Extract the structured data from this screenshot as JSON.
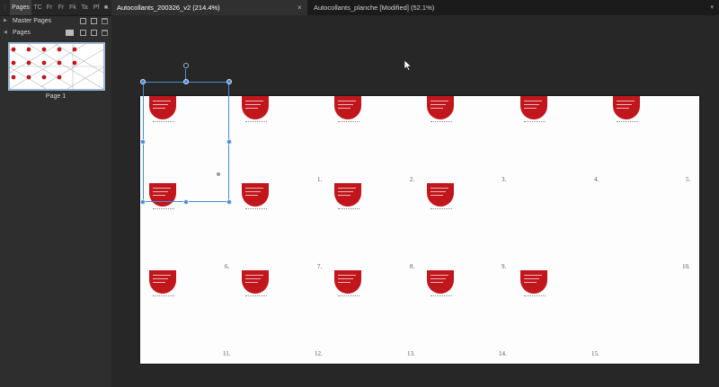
{
  "panel": {
    "tabs": [
      "Pages",
      "TC",
      "Fr",
      "Fr",
      "Fk",
      "Ta",
      "Pf",
      "■."
    ],
    "master_pages_label": "Master Pages",
    "pages_label": "Pages",
    "thumbnail_caption": "Page 1"
  },
  "documents": [
    {
      "title": "Autocollants_200326_v2 (214.4%)",
      "active": true
    },
    {
      "title": "Autocollants_planche [Modified] (52.1%)",
      "active": false
    }
  ],
  "close_glyph": "×",
  "canvas": {
    "cell_numbers": [
      "1.",
      "2.",
      "3.",
      "4.",
      "5.",
      "6.",
      "7.",
      "8.",
      "9.",
      "10.",
      "11.",
      "12.",
      "13.",
      "14.",
      "15."
    ]
  },
  "colors": {
    "sticker_red": "#c0161c",
    "selection_blue": "#4a8ad8",
    "thumbnail_border": "#9fb6d6"
  },
  "icons": [
    "grip-icon",
    "caret-right-icon",
    "caret-down-icon",
    "add-page-icon",
    "master-icon",
    "trash-icon",
    "cursor-icon"
  ]
}
